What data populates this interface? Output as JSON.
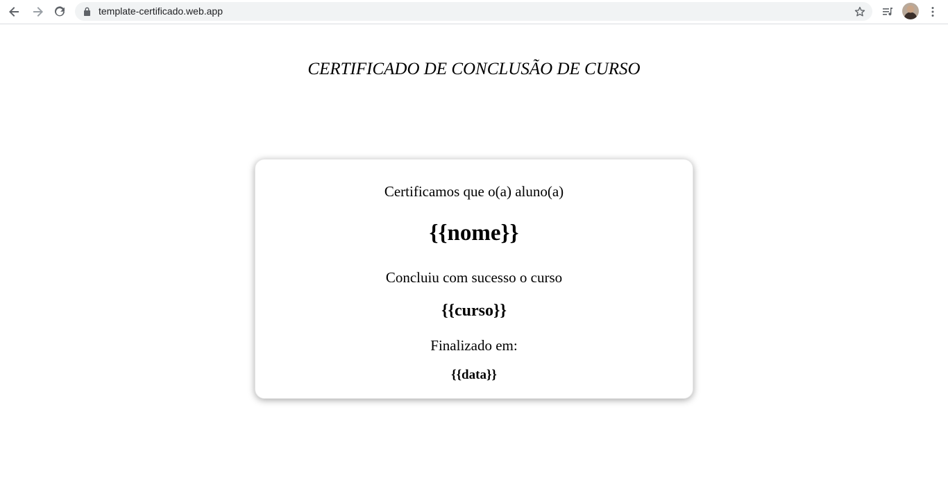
{
  "browser": {
    "url": "template-certificado.web.app",
    "icons": [
      "back-icon",
      "forward-icon",
      "reload-icon",
      "lock-icon",
      "star-icon",
      "media-control-icon",
      "avatar",
      "more-icon"
    ]
  },
  "page": {
    "title": "CERTIFICADO DE CONCLUSÃO DE CURSO"
  },
  "certificate": {
    "intro": "Certificamos que o(a) aluno(a)",
    "name": "{{nome}}",
    "completed_text": "Concluiu com sucesso o curso",
    "course": "{{curso}}",
    "finished_label": "Finalizado em:",
    "date": "{{data}}"
  }
}
